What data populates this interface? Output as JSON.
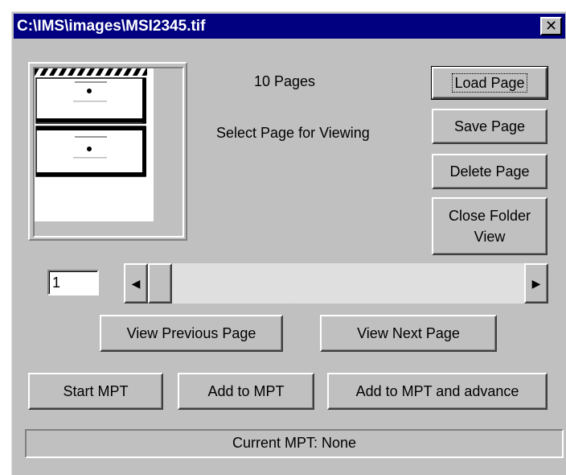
{
  "window": {
    "title": "C:\\IMS\\images\\MSI2345.tif",
    "close_glyph": "✕"
  },
  "info": {
    "page_count": "10 Pages",
    "instruction": "Select Page for Viewing"
  },
  "page_buttons": {
    "load": "Load Page",
    "save": "Save Page",
    "delete": "Delete Page",
    "close_folder_line1": "Close Folder",
    "close_folder_line2": "View"
  },
  "page_number_input": {
    "value": "1"
  },
  "scrollbar": {
    "left_arrow": "◀",
    "right_arrow": "▶",
    "position": 1,
    "max": 10
  },
  "nav_buttons": {
    "previous": "View Previous Page",
    "next": "View Next Page"
  },
  "mpt_buttons": {
    "start": "Start MPT",
    "add": "Add to MPT",
    "add_advance": "Add to MPT and advance"
  },
  "status": {
    "current_mpt": "Current MPT: None"
  },
  "colors": {
    "titlebar": "#000080",
    "face": "#c0c0c0"
  }
}
